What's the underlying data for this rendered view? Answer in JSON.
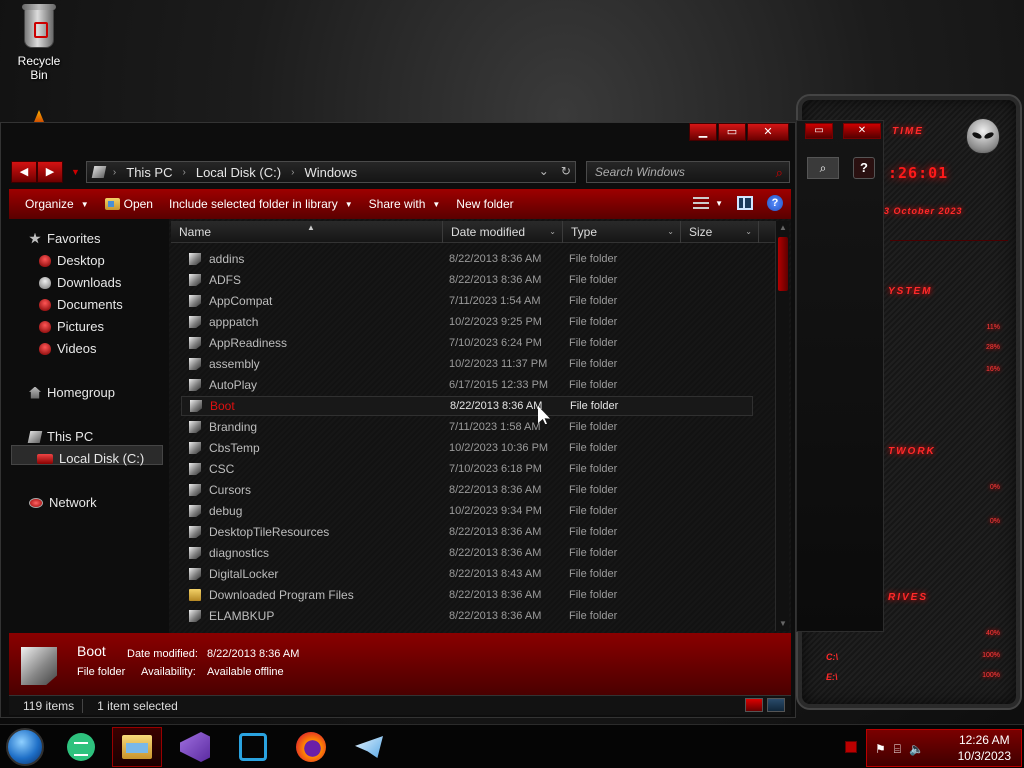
{
  "desktop": {
    "recycle_bin_label": "Recycle Bin"
  },
  "widget": {
    "time_label": "TIME",
    "time_value": ":26:01",
    "date_value": "3 October 2023",
    "system_label": "YSTEM",
    "system_pcts": [
      "11%",
      "28%",
      "16%"
    ],
    "network_label": "TWORK",
    "network_pcts": [
      "0%",
      "0%"
    ],
    "drives_label": "RIVES",
    "drives": [
      {
        "letter": "C:\\",
        "pct": "100%",
        "free": "40%"
      },
      {
        "letter": "E:\\",
        "pct": "100%",
        "free": "100%"
      }
    ]
  },
  "window": {
    "breadcrumbs": [
      "This PC",
      "Local Disk (C:)",
      "Windows"
    ],
    "search_placeholder": "Search Windows"
  },
  "toolbar": {
    "organize": "Organize",
    "open": "Open",
    "include": "Include selected folder in library",
    "share": "Share with",
    "new_folder": "New folder"
  },
  "navpane": {
    "favorites": "Favorites",
    "desktop": "Desktop",
    "downloads": "Downloads",
    "documents": "Documents",
    "pictures": "Pictures",
    "videos": "Videos",
    "homegroup": "Homegroup",
    "this_pc": "This PC",
    "local_disk": "Local Disk (C:)",
    "network": "Network"
  },
  "columns": {
    "name": "Name",
    "date": "Date modified",
    "type": "Type",
    "size": "Size"
  },
  "files": [
    {
      "name": "addins",
      "date": "8/22/2013 8:36 AM",
      "type": "File folder"
    },
    {
      "name": "ADFS",
      "date": "8/22/2013 8:36 AM",
      "type": "File folder"
    },
    {
      "name": "AppCompat",
      "date": "7/11/2023 1:54 AM",
      "type": "File folder"
    },
    {
      "name": "apppatch",
      "date": "10/2/2023 9:25 PM",
      "type": "File folder"
    },
    {
      "name": "AppReadiness",
      "date": "7/10/2023 6:24 PM",
      "type": "File folder"
    },
    {
      "name": "assembly",
      "date": "10/2/2023 11:37 PM",
      "type": "File folder"
    },
    {
      "name": "AutoPlay",
      "date": "6/17/2015 12:33 PM",
      "type": "File folder"
    },
    {
      "name": "Boot",
      "date": "8/22/2013 8:36 AM",
      "type": "File folder"
    },
    {
      "name": "Branding",
      "date": "7/11/2023 1:58 AM",
      "type": "File folder"
    },
    {
      "name": "CbsTemp",
      "date": "10/2/2023 10:36 PM",
      "type": "File folder"
    },
    {
      "name": "CSC",
      "date": "7/10/2023 6:18 PM",
      "type": "File folder"
    },
    {
      "name": "Cursors",
      "date": "8/22/2013 8:36 AM",
      "type": "File folder"
    },
    {
      "name": "debug",
      "date": "10/2/2023 9:34 PM",
      "type": "File folder"
    },
    {
      "name": "DesktopTileResources",
      "date": "8/22/2013 8:36 AM",
      "type": "File folder"
    },
    {
      "name": "diagnostics",
      "date": "8/22/2013 8:36 AM",
      "type": "File folder"
    },
    {
      "name": "DigitalLocker",
      "date": "8/22/2013 8:43 AM",
      "type": "File folder"
    },
    {
      "name": "Downloaded Program Files",
      "date": "8/22/2013 8:36 AM",
      "type": "File folder"
    },
    {
      "name": "ELAMBKUP",
      "date": "8/22/2013 8:36 AM",
      "type": "File folder"
    }
  ],
  "details": {
    "name": "Boot",
    "type": "File folder",
    "date_key": "Date modified:",
    "date_value": "8/22/2013 8:36 AM",
    "avail_key": "Availability:",
    "avail_value": "Available offline"
  },
  "status": {
    "count": "119 items",
    "selection": "1 item selected"
  },
  "taskbar": {
    "time": "12:26 AM",
    "date": "10/3/2023"
  },
  "colors": {
    "accent": "#b00000",
    "selected_name": "#e01010"
  }
}
